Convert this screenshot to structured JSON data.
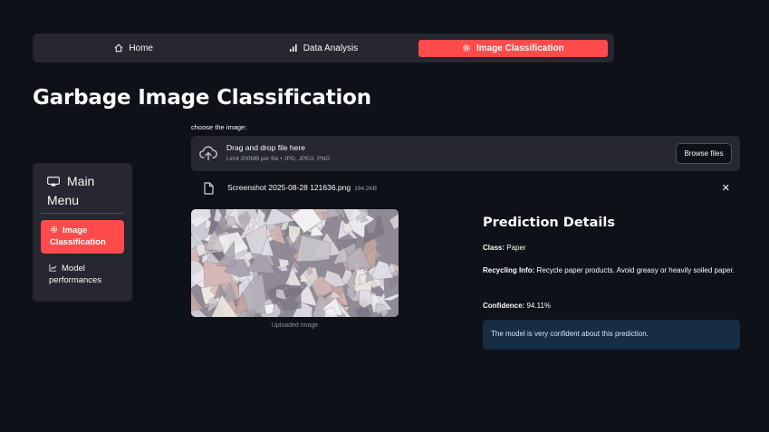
{
  "nav": {
    "items": [
      {
        "label": "Home",
        "icon": "home-icon"
      },
      {
        "label": "Data Analysis",
        "icon": "bar-chart-icon"
      },
      {
        "label": "Image Classification",
        "icon": "gear-icon"
      }
    ],
    "active_color": "#ff4b4b"
  },
  "page": {
    "title": "Garbage Image Classification"
  },
  "sidebar": {
    "header_line1": "Main",
    "header_line2": "Menu",
    "header_icon": "cast-icon",
    "items": [
      {
        "line1": "Image",
        "line2": "Classification",
        "icon": "gear-icon",
        "active": true
      },
      {
        "line1": "Model",
        "line2": "performances",
        "icon": "line-chart-icon",
        "active": false
      }
    ]
  },
  "uploader": {
    "label": "choose the image:",
    "drop_title": "Drag and drop file here",
    "drop_limit": "Limit 200MB per file • JPG, JPEG, PNG",
    "browse_label": "Browse files",
    "file": {
      "name": "Screenshot 2025-08-28 121636.png",
      "size": "194.2KB"
    }
  },
  "image": {
    "caption": "Uploaded Image"
  },
  "prediction": {
    "title": "Prediction Details",
    "class_label": "Class:",
    "class_value": "Paper",
    "recycling_label": "Recycling Info:",
    "recycling_value": "Recycle paper products. Avoid greasy or heavily soiled paper.",
    "confidence_label": "Confidence:",
    "confidence_value": "94.11%",
    "info_message": "The model is very confident about this prediction."
  },
  "colors": {
    "background": "#0e1117",
    "panel": "#262730",
    "accent": "#ff4b4b",
    "info_bg": "#172d43",
    "info_text": "#c7ebff"
  }
}
